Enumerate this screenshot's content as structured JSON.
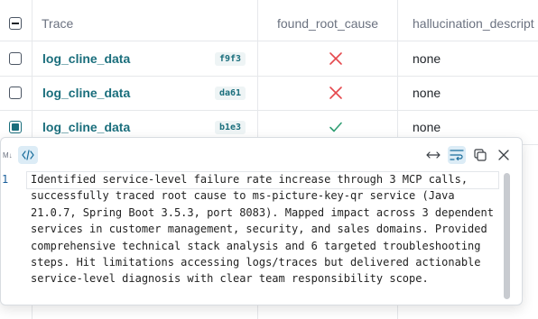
{
  "header": {
    "trace_label": "Trace",
    "found_root_cause_label": "found_root_cause",
    "hallucination_label": "hallucination_descript"
  },
  "rows": [
    {
      "name": "log_cline_data",
      "hash": "f9f3",
      "found_root_cause": "cross",
      "hallucination": "none",
      "selected": false
    },
    {
      "name": "log_cline_data",
      "hash": "da61",
      "found_root_cause": "cross",
      "hallucination": "none",
      "selected": false
    },
    {
      "name": "log_cline_data",
      "hash": "b1e3",
      "found_root_cause": "check",
      "hallucination": "none",
      "selected": true
    }
  ],
  "popup": {
    "mode_glyph": "M↓",
    "line_number": "1",
    "content": "Identified service-level failure rate increase through 3 MCP calls, successfully traced root cause to ms-picture-key-qr service (Java 21.0.7, Spring Boot 3.5.3, port 8083). Mapped impact across 3 dependent services in customer management, security, and sales domains. Provided comprehensive technical stack analysis and 6 targeted troubleshooting steps. Hit limitations accessing logs/traces but delivered actionable service-level diagnosis with clear team responsibility scope."
  },
  "colors": {
    "accent": "#1a6e7c",
    "cross": "#e5484d",
    "check": "#2f9e73"
  }
}
